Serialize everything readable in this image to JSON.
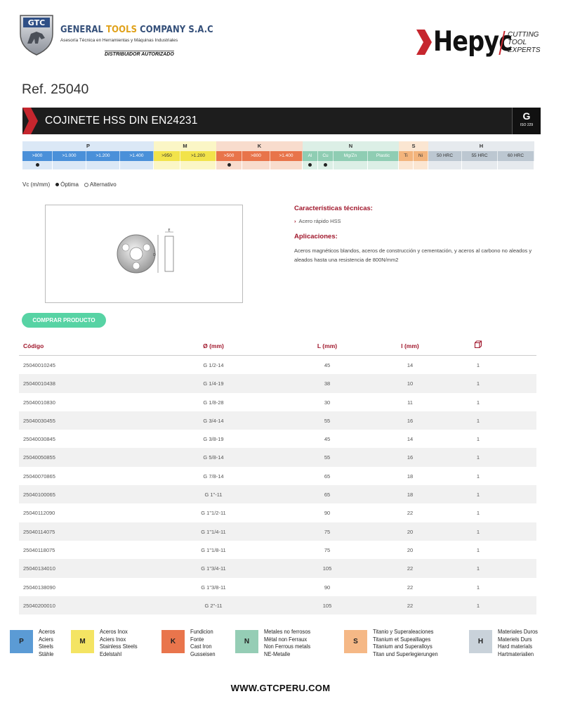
{
  "header": {
    "company_initials": "GTC",
    "company_name_part1": "GENERAL ",
    "company_name_part2": "TOOLS",
    "company_name_part3": " COMPANY S.A.C",
    "company_subtitle": "Asesoría Técnica en Herramientas y Máquinas Industriales",
    "distributor": "DISTRIBUIDOR AUTORIZADO",
    "brand_name": "Hepyc",
    "brand_tagline": [
      "CUTTING",
      "TOOL",
      "EXPERTS"
    ]
  },
  "reference": "Ref. 25040",
  "product_title": "COJINETE HSS DIN EN24231",
  "iso_group": {
    "letter": "G",
    "label": "ISO 229"
  },
  "materials": {
    "groups": [
      {
        "name": "P",
        "color": "#4a90d9",
        "light": "#dbe8f6",
        "subs": [
          ">800",
          ">1.000",
          ">1.200",
          ">1.400"
        ],
        "dots": [
          true,
          false,
          false,
          false
        ]
      },
      {
        "name": "M",
        "color": "#f2e34a",
        "light": "#fbf6c6",
        "subs": [
          ">950",
          ">1.200"
        ],
        "dots": [
          false,
          false
        ]
      },
      {
        "name": "K",
        "color": "#e8744a",
        "light": "#f8dccd",
        "subs": [
          ">500",
          ">800",
          ">1.400"
        ],
        "dots": [
          true,
          false,
          false
        ]
      },
      {
        "name": "N",
        "color": "#8fcdb3",
        "light": "#dcefe6",
        "subs": [
          "Al",
          "Cu",
          "Mg/Zn",
          "Plastic"
        ],
        "dots": [
          true,
          true,
          false,
          false
        ]
      },
      {
        "name": "S",
        "color": "#f3b47c",
        "light": "#fbe6d2",
        "subs": [
          "Ti",
          "Ni"
        ],
        "dots": [
          false,
          false
        ]
      },
      {
        "name": "H",
        "color": "#bcc7d1",
        "light": "#e6eaee",
        "subs": [
          "50 HRC",
          "55 HRC",
          "60 HRC"
        ],
        "dots": [
          false,
          false,
          false
        ]
      }
    ]
  },
  "legend": {
    "vc": "Vc (m/mm)",
    "optimal": "Óptima",
    "alternative": "Alternativo"
  },
  "specs": {
    "title": "Características técnicas:",
    "bullet": "Acero rápido HSS",
    "app_title": "Aplicaciones:",
    "app_text": "Aceros magnéticos blandos, aceros de construcción y cementación, y aceros al carbono no aleados y aleados hasta una resistencia de 800N/mm2"
  },
  "buy_button": "COMPRAR PRODUCTO",
  "table": {
    "headers": [
      "Código",
      "Ø (mm)",
      "L (mm)",
      "l (mm)"
    ],
    "rows": [
      [
        "25040010245",
        "G 1/2-14",
        "45",
        "14",
        "1"
      ],
      [
        "25040010438",
        "G 1/4-19",
        "38",
        "10",
        "1"
      ],
      [
        "25040010830",
        "G 1/8-28",
        "30",
        "11",
        "1"
      ],
      [
        "25040030455",
        "G 3/4-14",
        "55",
        "16",
        "1"
      ],
      [
        "25040030845",
        "G 3/8-19",
        "45",
        "14",
        "1"
      ],
      [
        "25040050855",
        "G 5/8-14",
        "55",
        "16",
        "1"
      ],
      [
        "25040070865",
        "G 7/8-14",
        "65",
        "18",
        "1"
      ],
      [
        "25040100065",
        "G 1\"-11",
        "65",
        "18",
        "1"
      ],
      [
        "25040112090",
        "G 1\"1/2-11",
        "90",
        "22",
        "1"
      ],
      [
        "25040114075",
        "G 1\"1/4-11",
        "75",
        "20",
        "1"
      ],
      [
        "25040118075",
        "G 1\"1/8-11",
        "75",
        "20",
        "1"
      ],
      [
        "25040134010",
        "G 1\"3/4-11",
        "105",
        "22",
        "1"
      ],
      [
        "25040138090",
        "G 1\"3/8-11",
        "90",
        "22",
        "1"
      ],
      [
        "25040200010",
        "G 2\"-11",
        "105",
        "22",
        "1"
      ]
    ]
  },
  "footer_legend": [
    {
      "letter": "P",
      "color": "#5b9bd5",
      "lines": [
        "Aceros",
        "Aciers",
        "Steels",
        "Stähle"
      ]
    },
    {
      "letter": "M",
      "color": "#f4e463",
      "lines": [
        "Aceros Inox",
        "Aciers Inox",
        "Stainless Steels",
        "Edelstahl"
      ]
    },
    {
      "letter": "K",
      "color": "#e9754c",
      "lines": [
        "Fundicion",
        "Fonte",
        "Cast Iron",
        "Gusseisen"
      ]
    },
    {
      "letter": "N",
      "color": "#95cdb5",
      "lines": [
        "Metales no ferrosos",
        "Métal non Ferraux",
        "Non Ferrous metals",
        "NE-Metalle"
      ]
    },
    {
      "letter": "S",
      "color": "#f5b886",
      "lines": [
        "Titanio y Superaleaciones",
        "Titanium et Supealliages",
        "Titanium and Superalloys",
        "Titan und Superlegierungen"
      ]
    },
    {
      "letter": "H",
      "color": "#c9d2da",
      "lines": [
        "Materiales Duros",
        "Materiels Durs",
        "Hard materials",
        "Hartmaterialien"
      ]
    }
  ],
  "website": "WWW.GTCPERU.COM"
}
